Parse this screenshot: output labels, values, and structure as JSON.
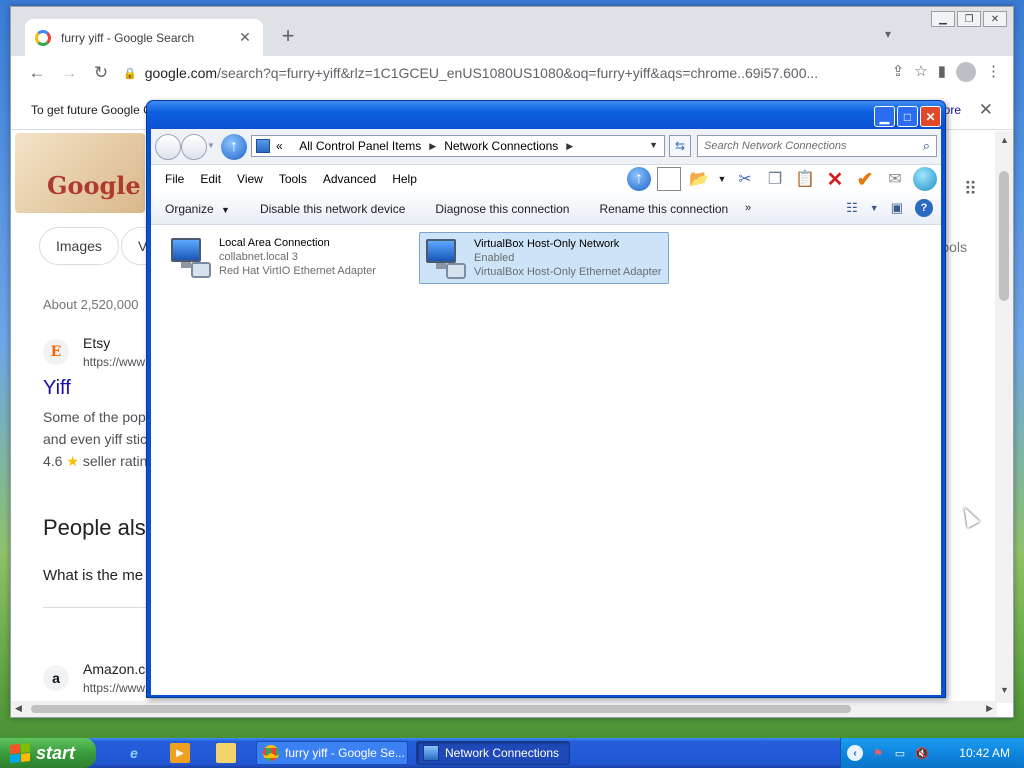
{
  "browser": {
    "tab_title": "furry yiff - Google Search",
    "url_host": "google.com",
    "url_rest": "/search?q=furry+yiff&rlz=1C1GCEU_enUS1080US1080&oq=furry+yiff&aqs=chrome..69i57.600...",
    "infobar_text": "To get future Google C",
    "infobar_more": "ore"
  },
  "google": {
    "doodle_text": "Google",
    "chips": [
      "Images",
      "Vi"
    ],
    "tools_label": "Tools",
    "results_count": "About 2,520,000",
    "result1": {
      "favicon": "E",
      "site": "Etsy",
      "url": "https://www",
      "title": "Yiff",
      "snippet1": "Some of the popu",
      "snippet2": "and even yiff stic",
      "rating_value": "4.6",
      "rating_star": "★",
      "rating_text": "seller ratin"
    },
    "paa_title": "People also",
    "paa_q1": "What is the me",
    "result2": {
      "favicon": "a",
      "site": "Amazon.co",
      "url": "https://www"
    }
  },
  "network_connections": {
    "breadcrumb": {
      "prefix": "«",
      "crumb1": "All Control Panel Items",
      "crumb2": "Network Connections"
    },
    "search_placeholder": "Search Network Connections",
    "menu": [
      "File",
      "Edit",
      "View",
      "Tools",
      "Advanced",
      "Help"
    ],
    "commands": {
      "organize": "Organize",
      "disable": "Disable this network device",
      "diagnose": "Diagnose this connection",
      "rename": "Rename this connection",
      "more": "»"
    },
    "connections": [
      {
        "name": "Local Area Connection",
        "status": "collabnet.local  3",
        "device": "Red Hat VirtIO Ethernet Adapter"
      },
      {
        "name": "VirtualBox Host-Only Network",
        "status": "Enabled",
        "device": "VirtualBox Host-Only Ethernet Adapter"
      }
    ]
  },
  "taskbar": {
    "start_label": "start",
    "tasks": [
      {
        "label": "furry yiff - Google Se..."
      },
      {
        "label": "Network Connections"
      }
    ],
    "clock": "10:42 AM"
  },
  "colors": {
    "xp_blue": "#0a50d0",
    "selected_item": "#cde3f8",
    "link": "#1a0dab"
  }
}
